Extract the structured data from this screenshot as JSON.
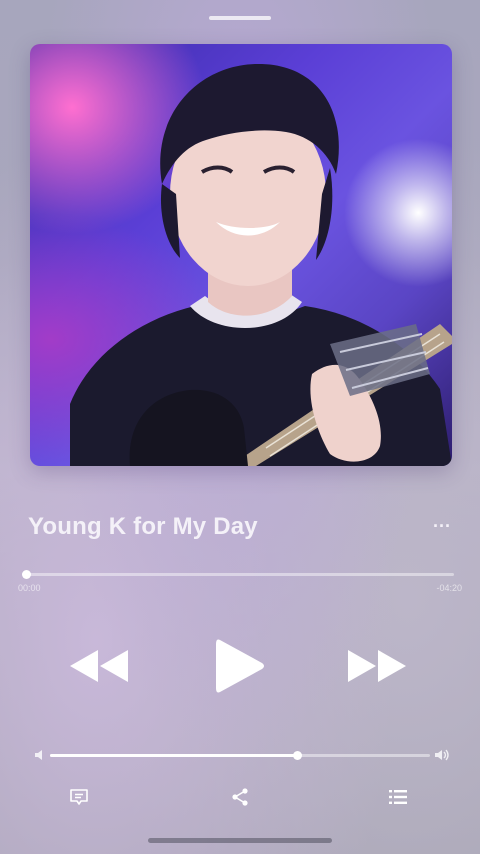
{
  "now_playing": {
    "title": "Young K for My Day",
    "more_label": "···",
    "elapsed": "00:00",
    "remaining": "-04:20",
    "progress": 0.0,
    "artwork_icon": "album-artwork"
  },
  "volume": {
    "level": 0.65
  },
  "icons": {
    "rewind": "rewind-icon",
    "play": "play-icon",
    "forward": "fast-forward-icon",
    "lyrics": "lyrics-icon",
    "share": "share-icon",
    "queue": "queue-list-icon",
    "volume_low": "speaker-low-icon",
    "volume_high": "speaker-high-icon"
  },
  "colors": {
    "accent": "#ffffff",
    "background": "#aeaabd"
  }
}
